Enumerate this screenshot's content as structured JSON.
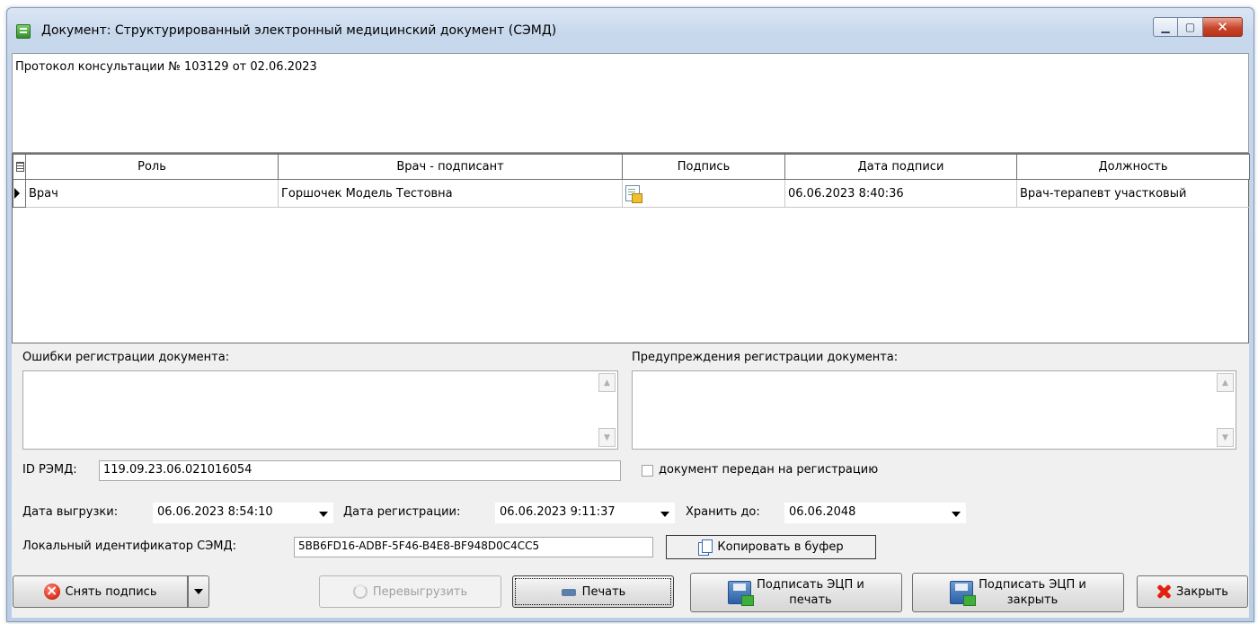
{
  "window": {
    "title": "Документ: Структурированный электронный медицинский документ (СЭМД)",
    "controls": {
      "minimize": "▁",
      "maximize": "▢",
      "close": "✕"
    }
  },
  "document_name": "Протокол консультации № 103129 от 02.06.2023",
  "signers_table": {
    "columns": [
      "Роль",
      "Врач - подписант",
      "Подпись",
      "Дата подписи",
      "Должность"
    ],
    "rows": [
      {
        "role": "Врач",
        "signer": "Горшочек Модель Тестовна",
        "signature_icon": "signed-document-icon",
        "date": "06.06.2023 8:40:36",
        "position": "Врач-терапевт участковый"
      }
    ]
  },
  "errors": {
    "label": "Ошибки регистрации документа:",
    "value": ""
  },
  "warnings": {
    "label": "Предупреждения регистрации документа:",
    "value": ""
  },
  "remd_id": {
    "label": "ID РЭМД:",
    "value": "119.09.23.06.021016054"
  },
  "sent_checkbox": {
    "label": "документ передан на регистрацию",
    "checked": false
  },
  "upload_date": {
    "label": "Дата выгрузки:",
    "value": "06.06.2023 8:54:10"
  },
  "registration_date": {
    "label": "Дата регистрации:",
    "value": "06.06.2023 9:11:37"
  },
  "keep_until": {
    "label": "Хранить до:",
    "value": "06.06.2048"
  },
  "local_id": {
    "label": "Локальный идентификатор СЭМД:",
    "value": "5BB6FD16-ADBF-5F46-B4E8-BF948D0C4CC5"
  },
  "copy_button": {
    "label": "Копировать в буфер"
  },
  "buttons": {
    "remove_signature": "Снять подпись",
    "reupload": "Перевыгрузить",
    "print": "Печать",
    "sign_print_line1": "Подписать ЭЦП и",
    "sign_print_line2": "печать",
    "sign_close_line1": "Подписать ЭЦП и",
    "sign_close_line2": "закрыть",
    "close": "Закрыть"
  }
}
